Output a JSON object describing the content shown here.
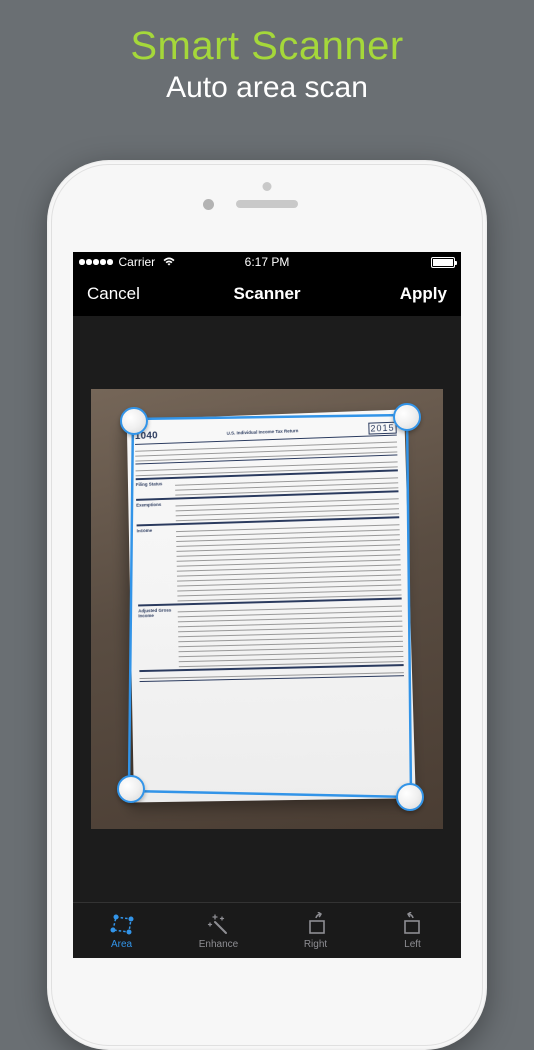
{
  "promo": {
    "title": "Smart Scanner",
    "subtitle": "Auto area scan"
  },
  "statusBar": {
    "carrier": "Carrier",
    "time": "6:17 PM"
  },
  "nav": {
    "cancel": "Cancel",
    "title": "Scanner",
    "apply": "Apply"
  },
  "document": {
    "formNumber": "1040",
    "formTitle": "U.S. Individual Income Tax Return",
    "year": "2015",
    "sections": {
      "filing": "Filing Status",
      "exemptions": "Exemptions",
      "income": "Income",
      "adjusted": "Adjusted Gross Income"
    }
  },
  "toolbar": {
    "area": "Area",
    "enhance": "Enhance",
    "right": "Right",
    "left": "Left"
  }
}
